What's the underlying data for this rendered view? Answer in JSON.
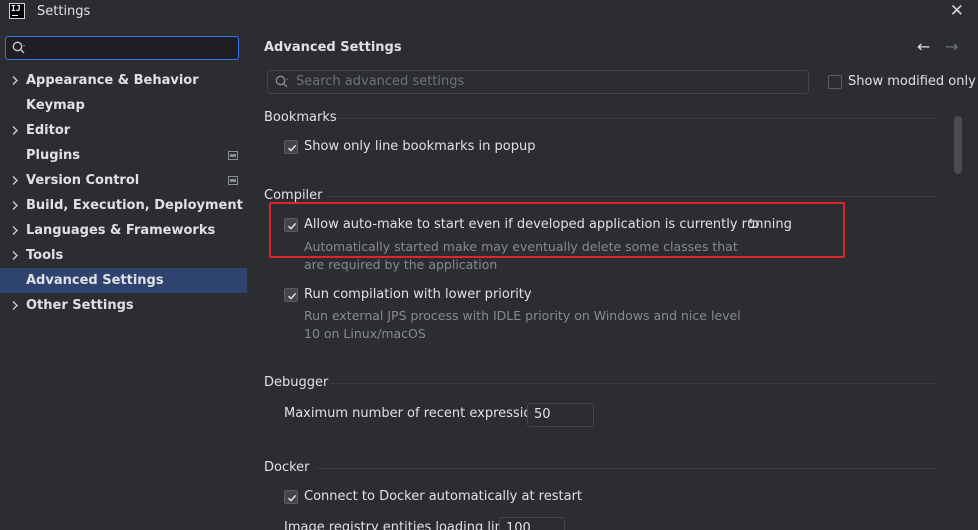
{
  "window": {
    "logo_text": "IJ",
    "title": "Settings",
    "close_glyph": "✕"
  },
  "sidebar": {
    "search_value": "",
    "items": [
      {
        "label": "Appearance & Behavior",
        "expandable": true,
        "badge": false,
        "selected": false
      },
      {
        "label": "Keymap",
        "expandable": false,
        "badge": false,
        "selected": false
      },
      {
        "label": "Editor",
        "expandable": true,
        "badge": false,
        "selected": false
      },
      {
        "label": "Plugins",
        "expandable": false,
        "badge": true,
        "selected": false
      },
      {
        "label": "Version Control",
        "expandable": true,
        "badge": true,
        "selected": false
      },
      {
        "label": "Build, Execution, Deployment",
        "expandable": true,
        "badge": false,
        "selected": false
      },
      {
        "label": "Languages & Frameworks",
        "expandable": true,
        "badge": false,
        "selected": false
      },
      {
        "label": "Tools",
        "expandable": true,
        "badge": false,
        "selected": false
      },
      {
        "label": "Advanced Settings",
        "expandable": false,
        "badge": false,
        "selected": true
      },
      {
        "label": "Other Settings",
        "expandable": true,
        "badge": false,
        "selected": false
      }
    ]
  },
  "main": {
    "title": "Advanced Settings",
    "back_glyph": "←",
    "forward_glyph": "→",
    "search_placeholder": "Search advanced settings",
    "show_modified_label": "Show modified only",
    "show_modified_checked": false,
    "sections": {
      "bookmarks": {
        "header": "Bookmarks",
        "opt1_label": "Show only line bookmarks in popup",
        "opt1_checked": true
      },
      "compiler": {
        "header": "Compiler",
        "opt1_label": "Allow auto-make to start even if developed application is currently running",
        "opt1_checked": true,
        "opt1_desc_line1": "Automatically started make may eventually delete some classes that",
        "opt1_desc_line2": "are required by the application",
        "opt2_label": "Run compilation with lower priority",
        "opt2_checked": true,
        "opt2_desc_line1": "Run external JPS process with IDLE priority on Windows and nice level",
        "opt2_desc_line2": "10 on Linux/macOS"
      },
      "debugger": {
        "header": "Debugger",
        "field_label": "Maximum number of recent expressions:",
        "field_value": "50"
      },
      "docker": {
        "header": "Docker",
        "opt1_label": "Connect to Docker automatically at restart",
        "opt1_checked": true,
        "field_label": "Image registry entities loading limit:",
        "field_value": "100"
      }
    }
  },
  "colors": {
    "background": "#2b2d30",
    "selection": "#2e436e",
    "focus_border": "#3574f0",
    "highlight_border": "#e0242b",
    "text": "#dfe1e5",
    "muted_text": "#868a91"
  }
}
